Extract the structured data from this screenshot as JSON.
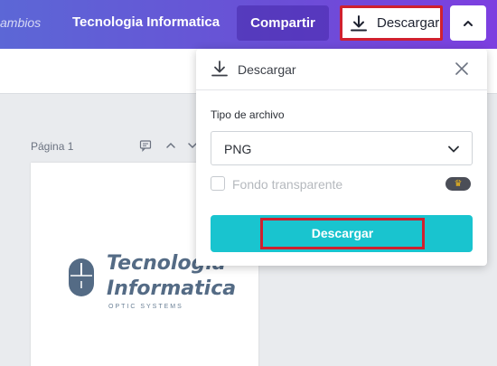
{
  "topbar": {
    "changes_text": "ambios",
    "doc_title": "Tecnologia Informatica",
    "share_label": "Compartir",
    "download_label": "Descargar"
  },
  "page": {
    "label": "Página 1",
    "logo": {
      "line1": "Tecnologia",
      "line2": "Informatica",
      "tagline": "OPTIC SYSTEMS"
    }
  },
  "download_panel": {
    "title": "Descargar",
    "file_type_label": "Tipo de archivo",
    "file_type_value": "PNG",
    "transparent_bg_label": "Fondo transparente",
    "transparent_bg_checked": false,
    "pro_badge_icon": "crown-icon",
    "download_button_label": "Descargar"
  },
  "colors": {
    "topbar_gradient_start": "#5c67d6",
    "topbar_gradient_end": "#7d3fe0",
    "primary_button": "#19c4cf",
    "highlight_border": "#d0202e",
    "logo_text": "#546b85"
  }
}
